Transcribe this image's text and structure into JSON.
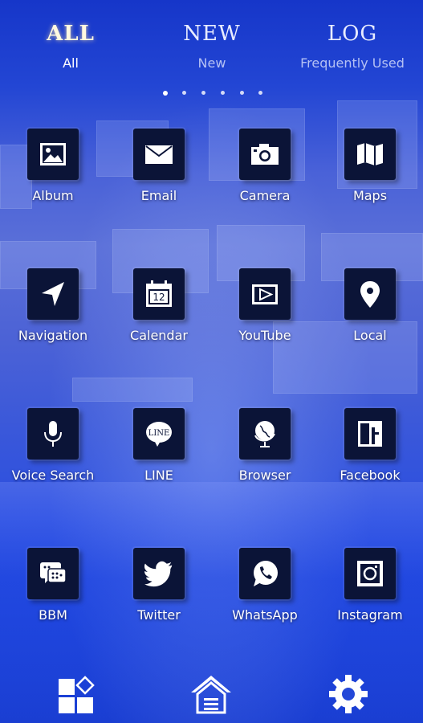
{
  "tabs": [
    {
      "title": "ALL",
      "subtitle": "All",
      "active": true
    },
    {
      "title": "NEW",
      "subtitle": "New",
      "active": false
    },
    {
      "title": "LOG",
      "subtitle": "Frequently Used",
      "active": false
    }
  ],
  "pager": {
    "count": 6,
    "current": 1
  },
  "apps": [
    {
      "label": "Album",
      "icon": "album-icon"
    },
    {
      "label": "Email",
      "icon": "email-icon"
    },
    {
      "label": "Camera",
      "icon": "camera-icon"
    },
    {
      "label": "Maps",
      "icon": "maps-icon"
    },
    {
      "label": "Navigation",
      "icon": "navigation-icon"
    },
    {
      "label": "Calendar",
      "icon": "calendar-icon",
      "badge": "12"
    },
    {
      "label": "YouTube",
      "icon": "youtube-icon"
    },
    {
      "label": "Local",
      "icon": "location-pin-icon"
    },
    {
      "label": "Voice Search",
      "icon": "microphone-icon"
    },
    {
      "label": "LINE",
      "icon": "line-icon",
      "badge": "LINE"
    },
    {
      "label": "Browser",
      "icon": "globe-icon"
    },
    {
      "label": "Facebook",
      "icon": "facebook-icon"
    },
    {
      "label": "BBM",
      "icon": "bbm-icon"
    },
    {
      "label": "Twitter",
      "icon": "twitter-icon"
    },
    {
      "label": "WhatsApp",
      "icon": "whatsapp-icon"
    },
    {
      "label": "Instagram",
      "icon": "instagram-icon"
    }
  ],
  "dock": [
    {
      "icon": "widgets-icon"
    },
    {
      "icon": "home-icon"
    },
    {
      "icon": "settings-gear-icon"
    }
  ],
  "colors": {
    "tile": "#0b1437",
    "background": "#1d3fc4",
    "active_tab_glow": "#fff8e0"
  }
}
